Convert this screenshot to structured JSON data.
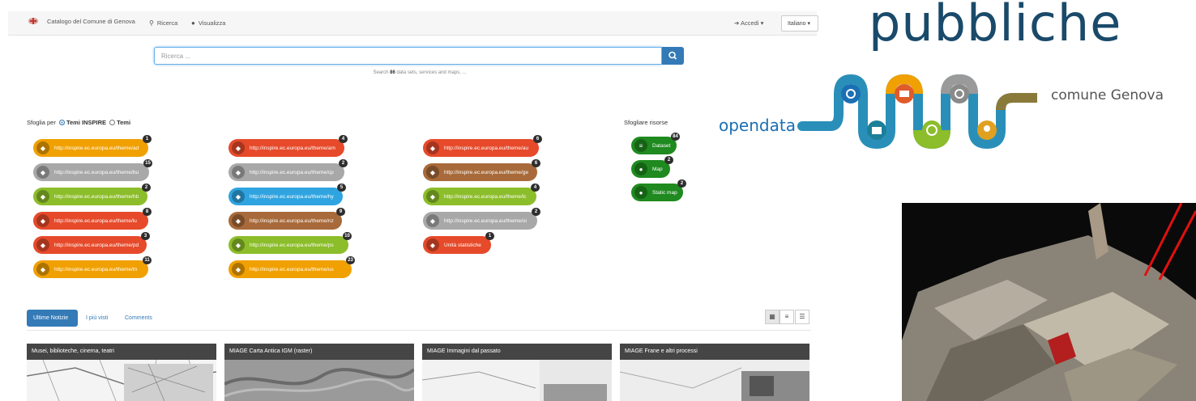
{
  "navbar": {
    "brand": "Catalogo del Comune di Genova",
    "search_link": "Ricerca",
    "view_link": "Visualizza",
    "login": "Accedi ▾",
    "language": "Italiano ▾"
  },
  "search": {
    "placeholder": "Ricerca ...",
    "hint_prefix": "Search",
    "hint_count": "86",
    "hint_suffix": "data sets, services and maps, ..."
  },
  "browse": {
    "label": "Sfoglia per",
    "option_inspire": "Temi INSPIRE",
    "option_temi": "Temi",
    "resources_title": "Sfogliare risorse",
    "topics": [
      {
        "label": "http://inspire.ec.europa.eu/theme/ad",
        "count": "1",
        "color": "#f0a000",
        "icon": "address-icon"
      },
      {
        "label": "http://inspire.ec.europa.eu/theme/bu",
        "count": "15",
        "color": "#a8a8a8",
        "icon": "building-icon"
      },
      {
        "label": "http://inspire.ec.europa.eu/theme/hb",
        "count": "2",
        "color": "#8cbd2a",
        "icon": "habitat-icon"
      },
      {
        "label": "http://inspire.ec.europa.eu/theme/lu",
        "count": "8",
        "color": "#e64a2a",
        "icon": "land-use-icon"
      },
      {
        "label": "http://inspire.ec.europa.eu/theme/pd",
        "count": "3",
        "color": "#e64a2a",
        "icon": "population-icon"
      },
      {
        "label": "http://inspire.ec.europa.eu/theme/tn",
        "count": "11",
        "color": "#f0a000",
        "icon": "transport-icon"
      },
      {
        "label": "http://inspire.ec.europa.eu/theme/am",
        "count": "4",
        "color": "#e64a2a",
        "icon": "management-icon"
      },
      {
        "label": "http://inspire.ec.europa.eu/theme/cp",
        "count": "2",
        "color": "#a8a8a8",
        "icon": "cadastral-icon"
      },
      {
        "label": "http://inspire.ec.europa.eu/theme/hy",
        "count": "5",
        "color": "#2fa4e0",
        "icon": "hydrography-icon"
      },
      {
        "label": "http://inspire.ec.europa.eu/theme/nz",
        "count": "9",
        "color": "#a86a3a",
        "icon": "hazard-icon"
      },
      {
        "label": "http://inspire.ec.europa.eu/theme/ps",
        "count": "10",
        "color": "#8cbd2a",
        "icon": "protected-site-icon"
      },
      {
        "label": "http://inspire.ec.europa.eu/theme/us",
        "count": "23",
        "color": "#f0a000",
        "icon": "utility-icon"
      },
      {
        "label": "http://inspire.ec.europa.eu/theme/au",
        "count": "6",
        "color": "#e64a2a",
        "icon": "admin-unit-icon"
      },
      {
        "label": "http://inspire.ec.europa.eu/theme/ge",
        "count": "6",
        "color": "#a86a3a",
        "icon": "geology-icon"
      },
      {
        "label": "http://inspire.ec.europa.eu/theme/lc",
        "count": "4",
        "color": "#8cbd2a",
        "icon": "land-cover-icon"
      },
      {
        "label": "http://inspire.ec.europa.eu/theme/oi",
        "count": "2",
        "color": "#a8a8a8",
        "icon": "orthoimagery-icon"
      },
      {
        "label": "Unità statistiche",
        "count": "1",
        "color": "#e64a2a",
        "icon": "statistics-icon"
      }
    ],
    "resources": [
      {
        "label": "Dataset",
        "count": "84",
        "color": "#1f8a1f"
      },
      {
        "label": "Map",
        "count": "2",
        "color": "#1f8a1f"
      },
      {
        "label": "Static map",
        "count": "2",
        "color": "#1f8a1f"
      }
    ]
  },
  "tabs": {
    "latest": "Ultime Notizie",
    "most_viewed": "I più visti",
    "comments": "Comments"
  },
  "cards": [
    {
      "title": "Musei, biblioteche, cinema, teatri"
    },
    {
      "title": "MIAGE Carta Antica IGM (raster)"
    },
    {
      "title": "MIAGE Immagini dal passato"
    },
    {
      "title": "MIAGE Frane e altri processi"
    }
  ],
  "branding": {
    "heading": "pubbliche",
    "opendata": "opendata",
    "comune": "comune Genova"
  },
  "colors": {
    "primary": "#337ab7",
    "heading": "#1a4a6a"
  }
}
